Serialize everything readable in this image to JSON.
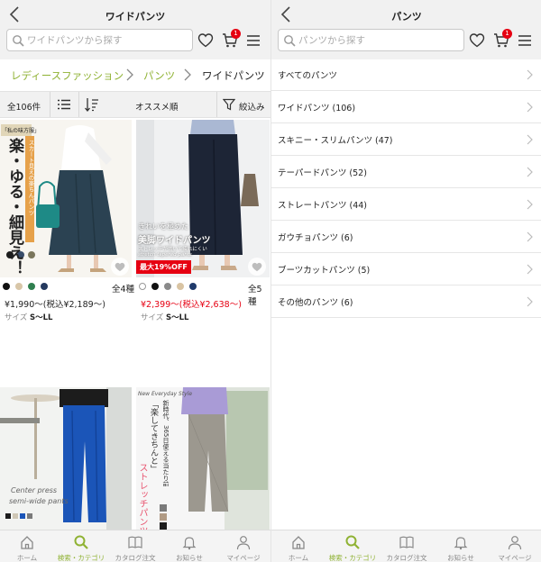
{
  "left": {
    "header": {
      "title": "ワイドパンツ",
      "search_placeholder": "ワイドパンツから探す",
      "cart_badge": "1"
    },
    "breadcrumb": [
      "レディースファッション",
      "パンツ",
      "ワイドパンツ"
    ],
    "toolbar": {
      "count": "全106件",
      "sort": "オススメ順",
      "filter": "絞込み"
    },
    "products": [
      {
        "image_lines": [
          "「私の味方服」",
          "楽・ゆる・細見え！",
          "スカート見えの楽ちんパンツ"
        ],
        "variants": "全4種",
        "swatches": [
          "#111111",
          "#d8c6a8",
          "#2f7f4f",
          "#24395e"
        ],
        "price": "¥1,990〜(税込¥2,189〜)",
        "size_label": "サイズ",
        "size": "S〜LL"
      },
      {
        "image_lines": [
          "きれいを極めた",
          "美脚ワイドパンツ",
          "ストレッチが効いて疲れにくい",
          "stretch tapered pants"
        ],
        "badge": "最大19%OFF",
        "variants": "全5種",
        "swatches": [
          "#ffffff",
          "#111111",
          "#8a8a8a",
          "#d9c4a3",
          "#1f3a6b"
        ],
        "price": "¥2,399〜(税込¥2,638〜)",
        "size_label": "サイズ",
        "size": "S〜LL"
      },
      {
        "image_lines": [
          "Center press",
          "semi-wide pants"
        ]
      },
      {
        "image_lines": [
          "New Everyday Style",
          "新時代、365日使える当たり前",
          "「楽してきちんと」",
          "ストレッチパンツ"
        ]
      }
    ],
    "bottom_nav": [
      {
        "label": "ホーム",
        "icon": "home-icon",
        "active": false
      },
      {
        "label": "検索・カテゴリ",
        "icon": "search-icon",
        "active": true
      },
      {
        "label": "カタログ注文",
        "icon": "catalog-icon",
        "active": false
      },
      {
        "label": "お知らせ",
        "icon": "bell-icon",
        "active": false
      },
      {
        "label": "マイページ",
        "icon": "user-icon",
        "active": false
      }
    ]
  },
  "right": {
    "header": {
      "title": "パンツ",
      "search_placeholder": "パンツから探す",
      "cart_badge": "1"
    },
    "categories": [
      "すべてのパンツ",
      "ワイドパンツ (106)",
      "スキニー・スリムパンツ (47)",
      "テーパードパンツ (52)",
      "ストレートパンツ (44)",
      "ガウチョパンツ (6)",
      "ブーツカットパンツ (5)",
      "その他のパンツ (6)"
    ],
    "bottom_nav": [
      {
        "label": "ホーム",
        "icon": "home-icon",
        "active": false
      },
      {
        "label": "検索・カテゴリ",
        "icon": "search-icon",
        "active": true
      },
      {
        "label": "カタログ注文",
        "icon": "catalog-icon",
        "active": false
      },
      {
        "label": "お知らせ",
        "icon": "bell-icon",
        "active": false
      },
      {
        "label": "マイページ",
        "icon": "user-icon",
        "active": false
      }
    ]
  },
  "colors": {
    "accent": "#8fb233",
    "sale": "#e60012",
    "header_bg": "#f1f1f1"
  }
}
